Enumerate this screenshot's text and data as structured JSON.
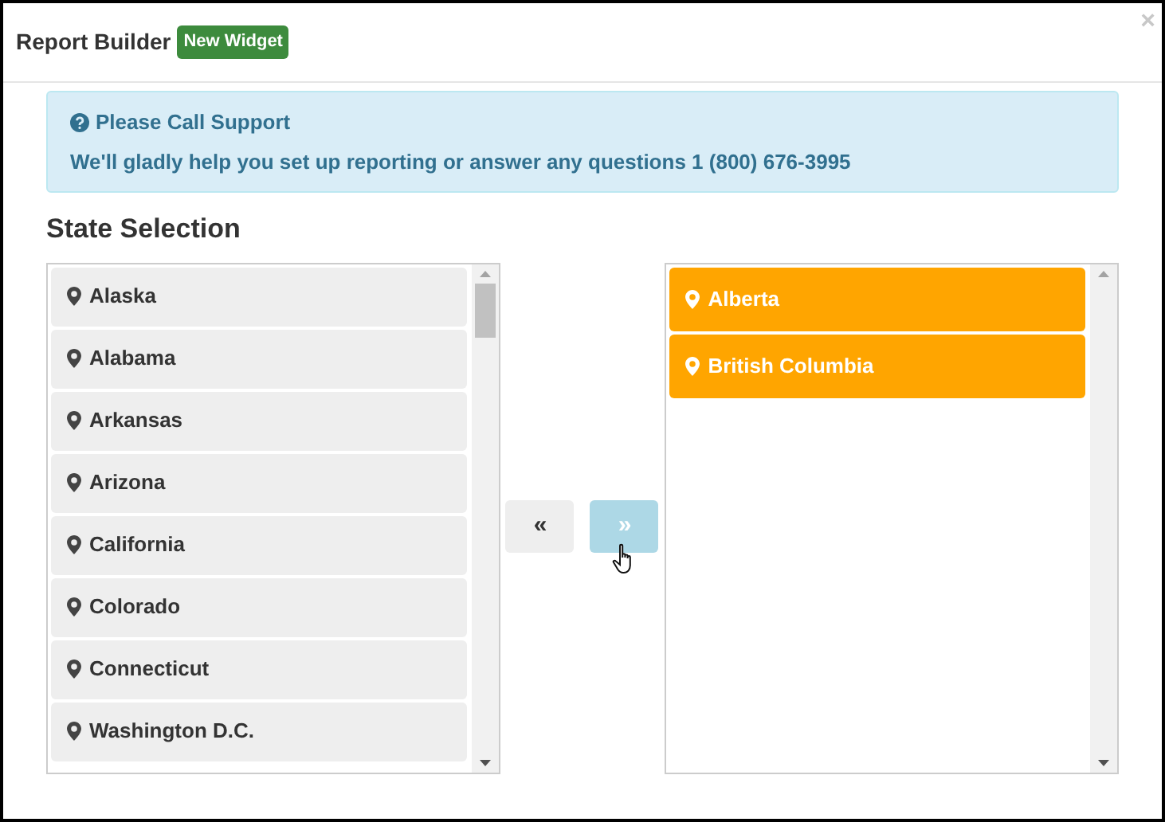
{
  "dialog": {
    "title": "Report Builder",
    "badge": "New Widget",
    "close": "×"
  },
  "alert": {
    "title": "Please Call Support",
    "message": "We'll gladly help you set up reporting or answer any questions **1 (800) 676-3995**"
  },
  "section_title": "State Selection",
  "available": [
    "Alaska",
    "Alabama",
    "Arkansas",
    "Arizona",
    "California",
    "Colorado",
    "Connecticut",
    "Washington D.C."
  ],
  "move_buttons": [
    {
      "label": "«",
      "hovered": false
    },
    {
      "label": "»",
      "hovered": true
    }
  ],
  "selected": [
    "Alberta",
    "British Columbia"
  ]
}
